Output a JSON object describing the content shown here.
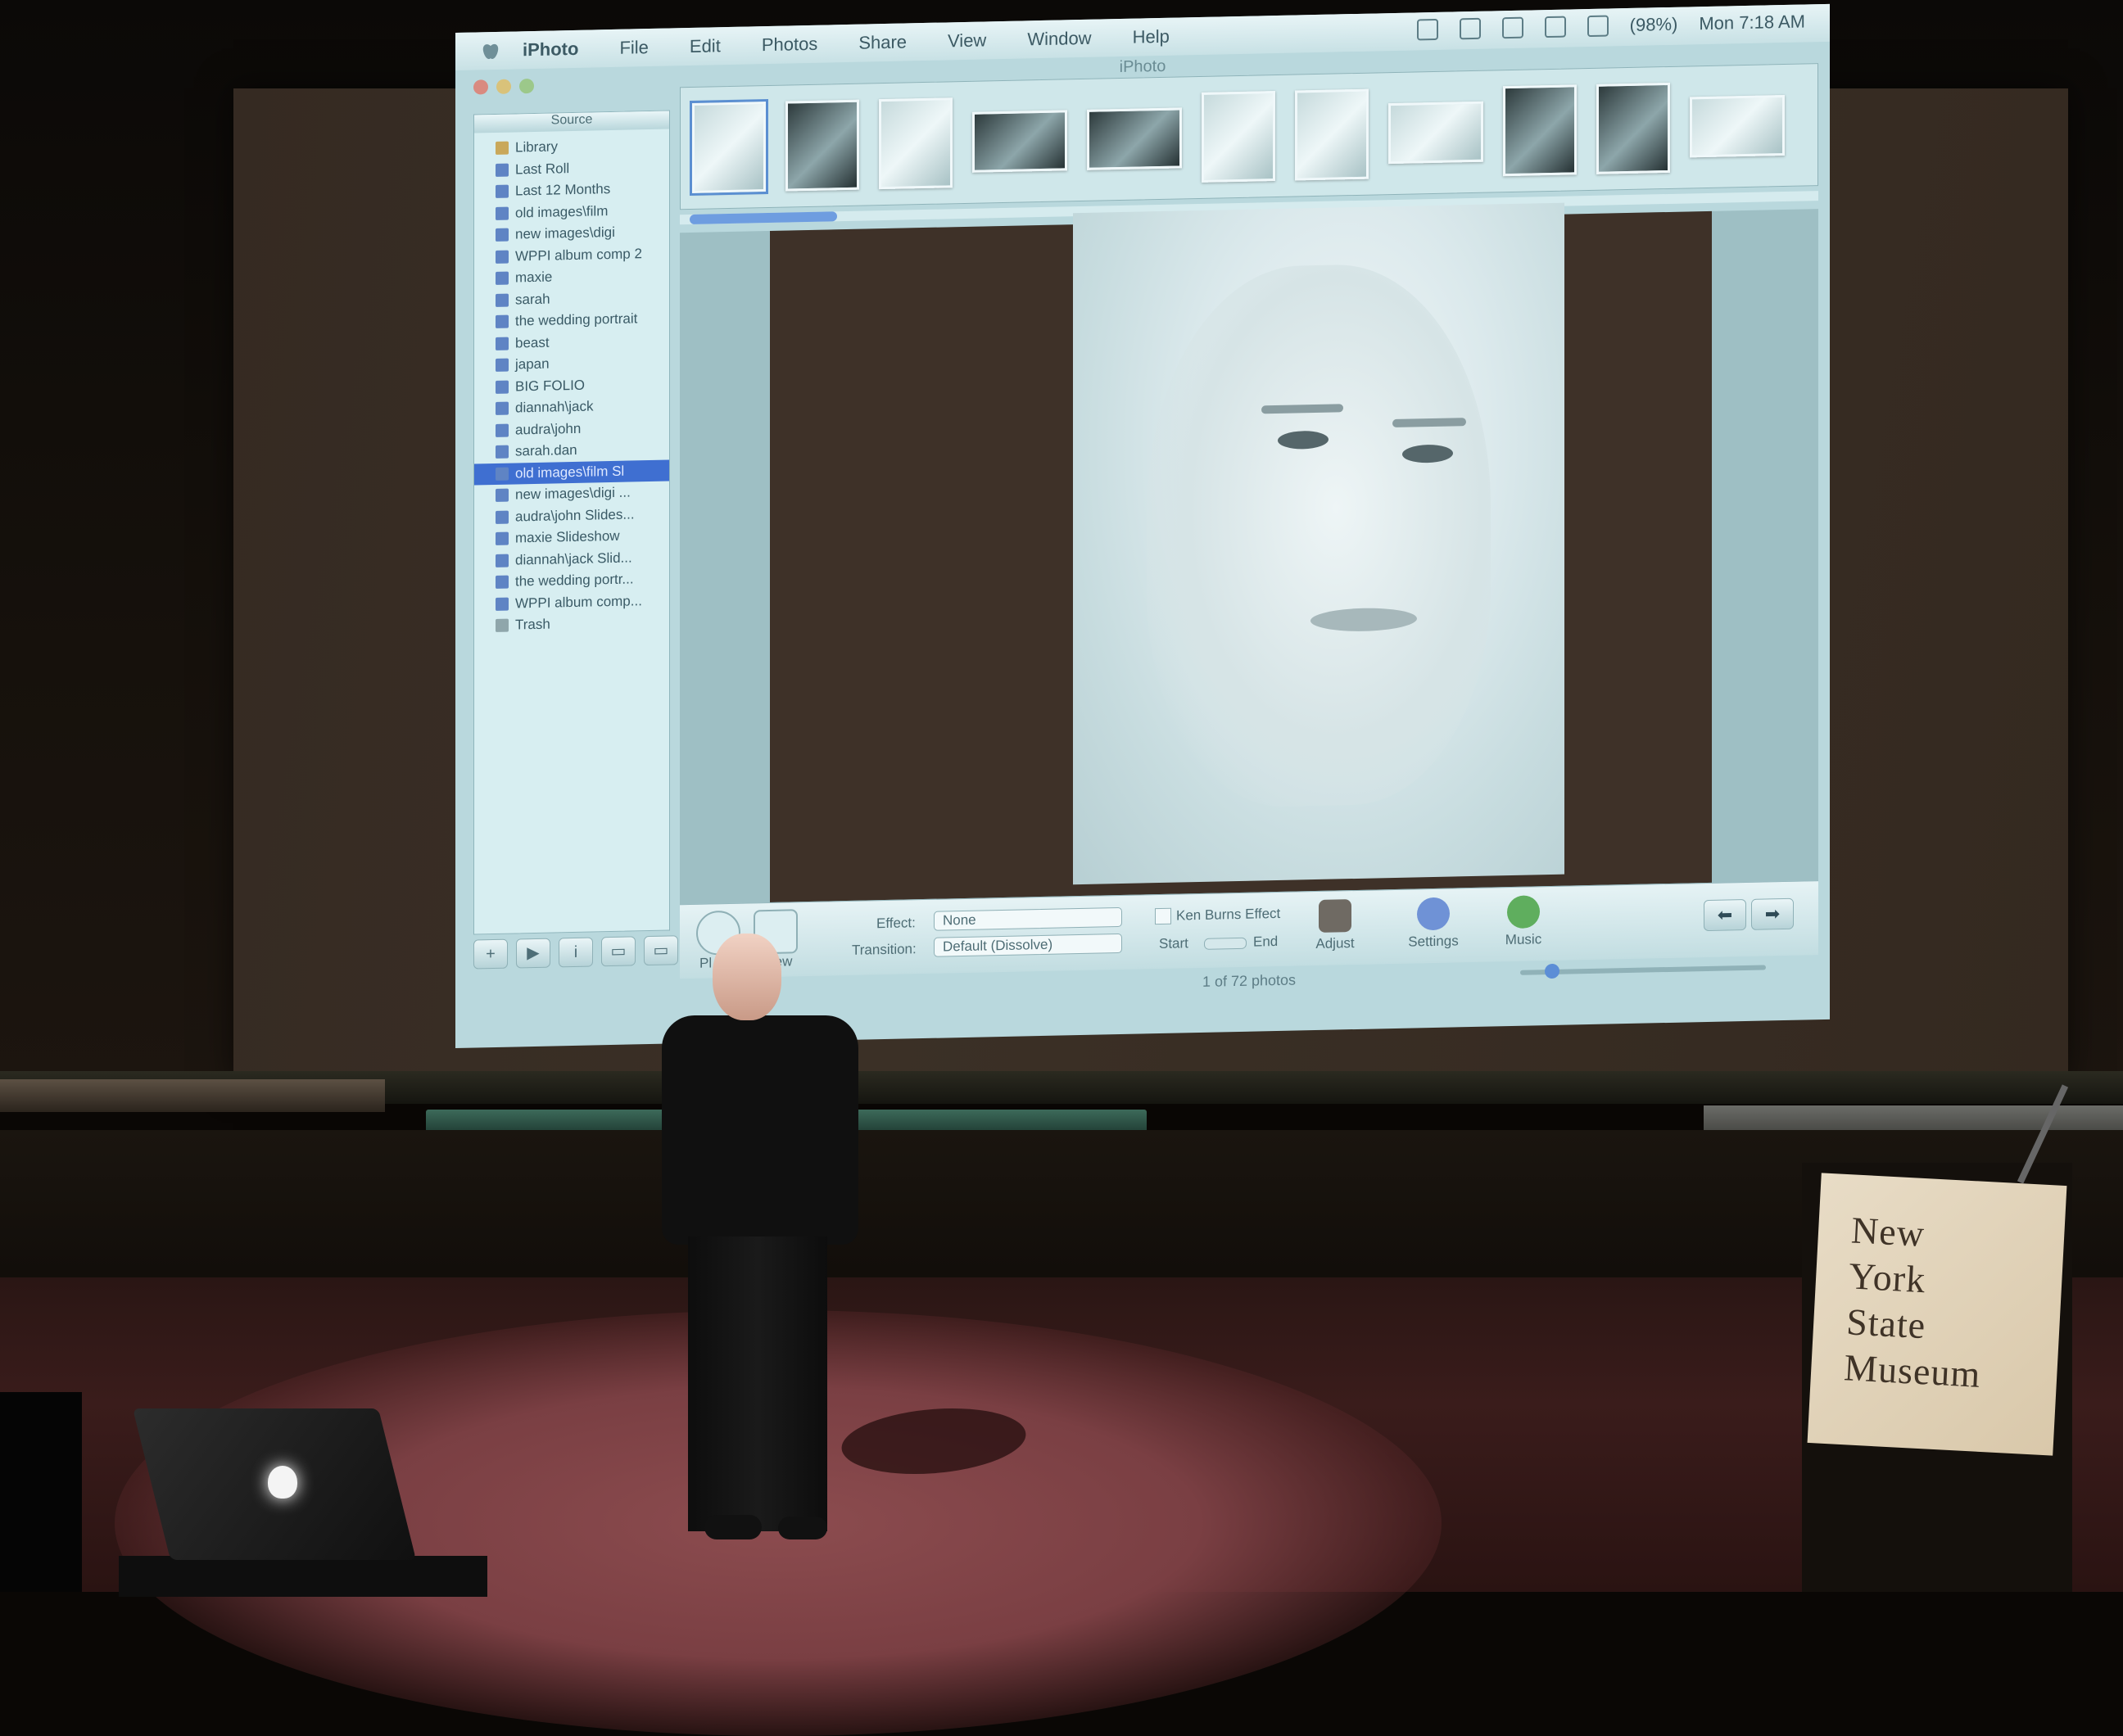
{
  "menubar": {
    "app_name": "iPhoto",
    "menus": [
      "File",
      "Edit",
      "Photos",
      "Share",
      "View",
      "Window",
      "Help"
    ],
    "battery": "(98%)",
    "clock": "Mon 7:18 AM"
  },
  "window": {
    "title": "iPhoto"
  },
  "source_pane": {
    "header": "Source",
    "items": [
      "Library",
      "Last Roll",
      "Last 12 Months",
      "old images\\film",
      "new images\\digi",
      "WPPI album comp 2",
      "maxie",
      "sarah",
      "the wedding portrait",
      "beast",
      "japan",
      "BIG FOLIO",
      "diannah\\jack",
      "audra\\john",
      "sarah.dan",
      "old images\\film Sl",
      "new images\\digi ...",
      "audra\\john Slides...",
      "maxie Slideshow",
      "diannah\\jack Slid...",
      "the wedding portr...",
      "WPPI album comp...",
      "Trash"
    ],
    "selected_index": 15,
    "buttons": [
      "+",
      "▶",
      "i",
      "▭",
      "▭"
    ]
  },
  "controls": {
    "effect_label": "Effect:",
    "effect_value": "None",
    "transition_label": "Transition:",
    "transition_value": "Default (Dissolve)",
    "ken_burns_label": "Ken Burns Effect",
    "start_label": "Start",
    "end_label": "End",
    "play_label": "Pl",
    "preview_label": "rew",
    "adjust_label": "Adjust",
    "settings_label": "Settings",
    "music_label": "Music",
    "prev_arrow": "⬅",
    "next_arrow": "➡"
  },
  "status_text": "1 of 72 photos",
  "podium_sign": [
    "New",
    "York",
    "State",
    "Museum"
  ],
  "colors": {
    "selection": "#3f6fd1",
    "screen_tint": "#b9d8dd",
    "floor": "#3a1c1b"
  }
}
